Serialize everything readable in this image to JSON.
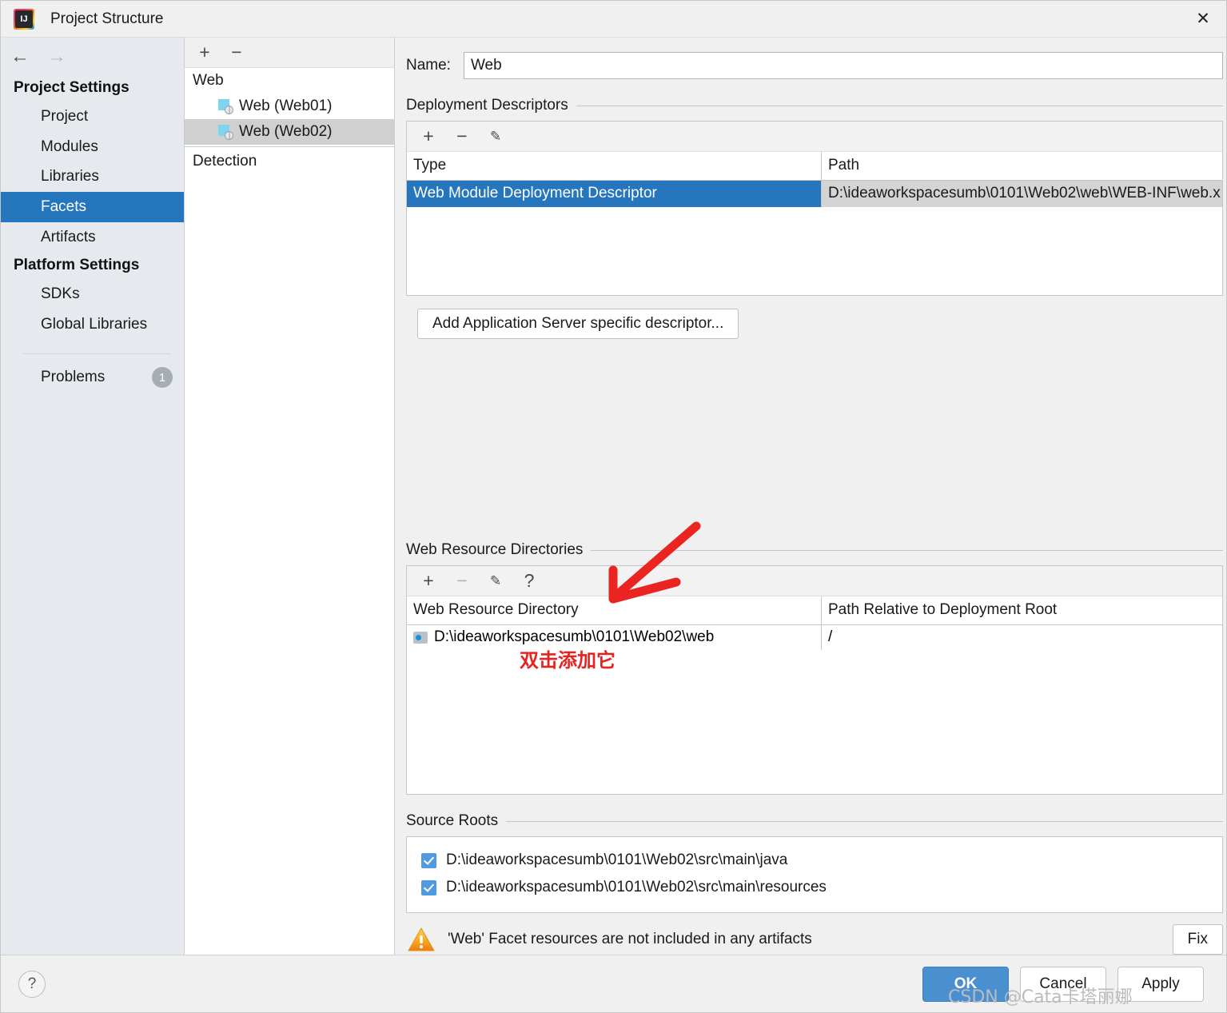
{
  "window": {
    "title": "Project Structure",
    "app_icon": "intellij-idea-logo",
    "close_icon": "✕"
  },
  "sidebar": {
    "nav": {
      "back_icon": "←",
      "forward_icon": "→"
    },
    "groups": [
      {
        "label": "Project Settings",
        "items": [
          {
            "label": "Project",
            "selected": false
          },
          {
            "label": "Modules",
            "selected": false
          },
          {
            "label": "Libraries",
            "selected": false
          },
          {
            "label": "Facets",
            "selected": true
          },
          {
            "label": "Artifacts",
            "selected": false
          }
        ]
      },
      {
        "label": "Platform Settings",
        "items": [
          {
            "label": "SDKs",
            "selected": false
          },
          {
            "label": "Global Libraries",
            "selected": false
          }
        ]
      }
    ],
    "problems": {
      "label": "Problems",
      "count": "1"
    }
  },
  "facet_tree": {
    "toolbar": {
      "add_icon": "+",
      "remove_icon": "−"
    },
    "root": "Web",
    "items": [
      {
        "label": "Web (Web01)",
        "selected": false
      },
      {
        "label": "Web (Web02)",
        "selected": true
      }
    ],
    "detection": "Detection"
  },
  "main": {
    "name_label": "Name:",
    "name_value": "Web",
    "deployment": {
      "title": "Deployment Descriptors",
      "toolbar": {
        "add_icon": "+",
        "remove_icon": "−",
        "edit_icon": "✎"
      },
      "columns": [
        "Type",
        "Path"
      ],
      "rows": [
        {
          "type": "Web Module Deployment Descriptor",
          "path": "D:\\ideaworkspacesumb\\0101\\Web02\\web\\WEB-INF\\web.x",
          "selected": true
        }
      ],
      "add_button": "Add Application Server specific descriptor..."
    },
    "web_resources": {
      "title": "Web Resource Directories",
      "toolbar": {
        "add_icon": "+",
        "remove_icon": "−",
        "edit_icon": "✎",
        "help_icon": "?"
      },
      "columns": [
        "Web Resource Directory",
        "Path Relative to Deployment Root"
      ],
      "rows": [
        {
          "directory": "D:\\ideaworkspacesumb\\0101\\Web02\\web",
          "relative_path": "/"
        }
      ]
    },
    "source_roots": {
      "title": "Source Roots",
      "items": [
        {
          "path": "D:\\ideaworkspacesumb\\0101\\Web02\\src\\main\\java",
          "checked": true
        },
        {
          "path": "D:\\ideaworkspacesumb\\0101\\Web02\\src\\main\\resources",
          "checked": true
        }
      ]
    },
    "warning": {
      "icon": "warning-triangle-icon",
      "text": "'Web' Facet resources are not included in any artifacts",
      "fix_button": "Fix"
    }
  },
  "footer": {
    "help_icon": "?",
    "ok": "OK",
    "cancel": "Cancel",
    "apply": "Apply"
  },
  "annotations": {
    "arrow": "red-arrow-pointing-to-web-resource-directory-row",
    "note": "双击添加它",
    "watermark": "CSDN @Cata卡塔丽娜"
  },
  "colors": {
    "selection_blue": "#2576bd",
    "ok_button_blue": "#4a8fd0",
    "annotation_red": "#e8221e",
    "sidebar_bg": "#e6eaee",
    "warning_orange": "#f5a623"
  }
}
